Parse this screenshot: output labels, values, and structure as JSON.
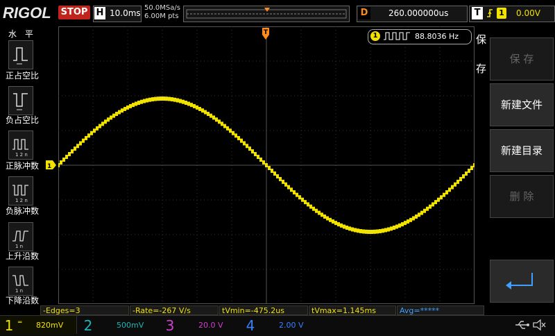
{
  "brand": "RIGOL",
  "status": "STOP",
  "timebase": {
    "label": "H",
    "value": "10.0ms"
  },
  "acquisition": {
    "sample_rate": "50.0MSa/s",
    "points": "6.00M pts"
  },
  "delay": {
    "label": "D",
    "value": "260.000000us"
  },
  "trigger": {
    "label": "T",
    "ch": "1",
    "level": "0.00V"
  },
  "left_menu": {
    "title": "水 平",
    "items": [
      {
        "label": "正占空比",
        "icon": "pos-duty-icon"
      },
      {
        "label": "负占空比",
        "icon": "neg-duty-icon"
      },
      {
        "label": "正脉冲数",
        "icon": "pos-pulse-count-icon"
      },
      {
        "label": "负脉冲数",
        "icon": "neg-pulse-count-icon"
      },
      {
        "label": "上升沿数",
        "icon": "rising-edge-count-icon"
      },
      {
        "label": "下降沿数",
        "icon": "falling-edge-count-icon"
      }
    ]
  },
  "freq_counter": {
    "ch": "1",
    "value": "88.8036 Hz"
  },
  "right_menu": {
    "side_title_1": "保",
    "side_title_2": "存",
    "buttons": [
      {
        "label": "保 存",
        "enabled": false
      },
      {
        "label": "新建文件",
        "enabled": true
      },
      {
        "label": "新建目录",
        "enabled": true
      },
      {
        "label": "删 除",
        "enabled": false
      }
    ]
  },
  "measurements": [
    "-Edges=3",
    "-Rate=-267 V/s",
    "tVmin=-475.2us",
    "tVmax=1.145ms",
    "Avg=*****"
  ],
  "channels": [
    {
      "num": "1",
      "scale": "820mV",
      "color": "#f2e200"
    },
    {
      "num": "2",
      "scale": "500mV",
      "color": "#1fb5b5"
    },
    {
      "num": "3",
      "scale": "20.0 V",
      "color": "#d040d0"
    },
    {
      "num": "4",
      "scale": "2.00 V",
      "color": "#3a7fff"
    }
  ],
  "colors": {
    "ch1": "#f2e200",
    "trigger": "#ff8c1a",
    "stop": "#c0241c"
  },
  "waveform": {
    "shape": "sine",
    "frequency_hz": 88.8036
  }
}
